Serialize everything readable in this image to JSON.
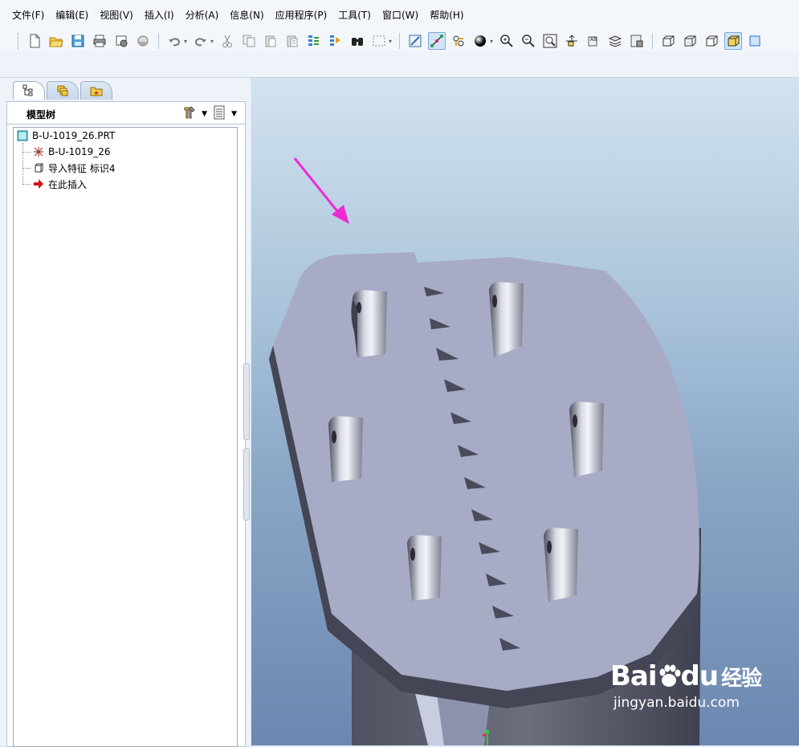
{
  "menu": [
    "文件(F)",
    "编辑(E)",
    "视图(V)",
    "插入(I)",
    "分析(A)",
    "信息(N)",
    "应用程序(P)",
    "工具(T)",
    "窗口(W)",
    "帮助(H)"
  ],
  "toolbar_icons": [
    "new-file-icon",
    "open-folder-icon",
    "save-icon",
    "print-icon",
    "save-copy-icon",
    "backup-icon",
    "undo-icon",
    "redo-icon",
    "cut-icon",
    "copy-icon",
    "paste-icon",
    "paste-special-icon",
    "regenerate-icon",
    "regenerate-manager-icon",
    "find-icon",
    "select-box-icon",
    "repaint-icon",
    "spin-center-icon",
    "orient-icon",
    "shading-icon",
    "zoom-in-icon",
    "zoom-out-icon",
    "refit-icon",
    "reorient-icon",
    "saved-views-icon",
    "layers-icon",
    "view-manager-icon",
    "wireframe-icon",
    "hidden-line-icon",
    "no-hidden-icon",
    "shaded-icon",
    "datum-planes-icon"
  ],
  "left_panel": {
    "tabs": [
      "model-tree-tab",
      "folder-browser-tab",
      "favorites-tab"
    ],
    "title": "模型树",
    "tree": [
      {
        "label": "B-U-1019_26.PRT",
        "icon": "part-icon"
      },
      {
        "label": "B-U-1019_26",
        "icon": "csys-icon"
      },
      {
        "label": "导入特征 标识4",
        "icon": "import-feature-icon"
      },
      {
        "label": "在此插入",
        "icon": "insert-here-arrow-icon"
      }
    ]
  },
  "viewport": {
    "model_color": "#a8abc6",
    "arrow_color": "#ee2bd6"
  },
  "watermark": {
    "brand": "Bai",
    "brand2": "du",
    "cn": "经验",
    "url": "jingyan.baidu.com"
  }
}
